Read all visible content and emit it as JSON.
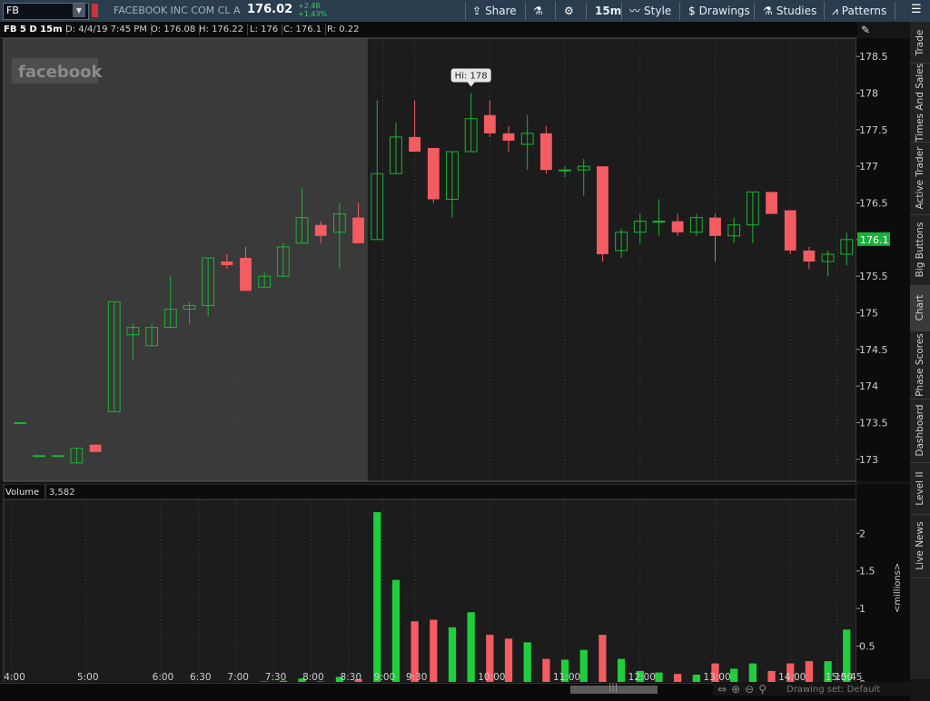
{
  "toolbar": {
    "symbol": "FB",
    "company": "FACEBOOK INC COM CL A",
    "last_price": "176.02",
    "change_abs": "+2.48",
    "change_pct": "+1.43%",
    "share_label": "Share",
    "timeframe_label": "15m",
    "style_label": "Style",
    "drawings_label": "Drawings",
    "studies_label": "Studies",
    "patterns_label": "Patterns",
    "icons": {
      "share": "share-icon",
      "flask": "flask-icon",
      "gear": "gear-icon",
      "style": "style-icon",
      "drawings": "drawings-icon",
      "studies": "studies-icon",
      "patterns": "patterns-icon",
      "menu": "menu-icon"
    }
  },
  "chart_header": {
    "symbol_label": "FB 5 D 15m",
    "date": "D: 4/4/19 7:45 PM",
    "open": "O: 176.08",
    "high": "H: 176.22",
    "low": "L: 176",
    "close": "C: 176.1",
    "range": "R: 0.22"
  },
  "watermark": "facebook",
  "high_bubble": "Hi: 178",
  "current_price_label": "176.1",
  "volume_panel": {
    "label": "Volume",
    "value": "3,582",
    "unit_label": "<millions>"
  },
  "sidebar_tabs": [
    "Trade",
    "Times And Sales",
    "Active Trader",
    "Big Buttons",
    "Chart",
    "Phase Scores",
    "Dashboard",
    "Level II",
    "Live News"
  ],
  "sidebar_active": "Chart",
  "footer": {
    "drawing_set": "Drawing set: Default"
  },
  "colors": {
    "up": "#19b533",
    "down": "#f45c62",
    "vol_up": "#1fce3c",
    "vol_down": "#f45c62",
    "premarket_bg": "#3a3a3a",
    "session_bg": "#1c1c1c",
    "price_tag": "#18b23a"
  },
  "chart_data": {
    "type": "candlestick",
    "y_price_ticks": [
      173,
      173.5,
      174,
      174.5,
      175,
      175.5,
      176,
      176.5,
      177,
      177.5,
      178,
      178.5
    ],
    "y_price_range": [
      172.7,
      178.75
    ],
    "y_volume_ticks": [
      0,
      0.5,
      1,
      1.5,
      2
    ],
    "y_volume_range": [
      0,
      2.45
    ],
    "x_ticks": [
      "4:00",
      "5:00",
      "6:00",
      "6:30",
      "7:00",
      "7:30",
      "8:00",
      "8:30",
      "9:00",
      "9:30",
      "10:00",
      "11:00",
      "12:00",
      "13:00",
      "14:00",
      "15:00",
      "15:45"
    ],
    "candles": [
      {
        "o": 173.5,
        "h": 173.5,
        "l": 173.5,
        "c": 173.5,
        "v": 0.005
      },
      {
        "o": 173.05,
        "h": 173.05,
        "l": 173.05,
        "c": 173.05,
        "v": 0.005
      },
      {
        "o": 173.05,
        "h": 173.05,
        "l": 173.05,
        "c": 173.05,
        "v": 0.005
      },
      {
        "o": 172.95,
        "h": 173.15,
        "l": 172.95,
        "c": 173.15,
        "v": 0.01
      },
      {
        "o": 173.2,
        "h": 173.2,
        "l": 173.1,
        "c": 173.1,
        "v": 0.01
      },
      {
        "o": 173.65,
        "h": 175.15,
        "l": 173.65,
        "c": 175.15,
        "v": 0.005
      },
      {
        "o": 174.7,
        "h": 174.85,
        "l": 174.35,
        "c": 174.8,
        "v": 0.01
      },
      {
        "o": 174.55,
        "h": 174.85,
        "l": 174.55,
        "c": 174.8,
        "v": 0.01
      },
      {
        "o": 174.8,
        "h": 175.5,
        "l": 174.8,
        "c": 175.05,
        "v": 0.02
      },
      {
        "o": 175.05,
        "h": 175.15,
        "l": 174.85,
        "c": 175.1,
        "v": 0.01
      },
      {
        "o": 175.1,
        "h": 175.75,
        "l": 174.95,
        "c": 175.75,
        "v": 0.02
      },
      {
        "o": 175.7,
        "h": 175.8,
        "l": 175.6,
        "c": 175.65,
        "v": 0.02
      },
      {
        "o": 175.75,
        "h": 175.9,
        "l": 175.3,
        "c": 175.3,
        "v": 0.02
      },
      {
        "o": 175.35,
        "h": 175.55,
        "l": 175.35,
        "c": 175.5,
        "v": 0.03
      },
      {
        "o": 175.5,
        "h": 175.95,
        "l": 175.5,
        "c": 175.9,
        "v": 0.04
      },
      {
        "o": 175.95,
        "h": 176.7,
        "l": 175.95,
        "c": 176.3,
        "v": 0.07
      },
      {
        "o": 176.2,
        "h": 176.25,
        "l": 175.95,
        "c": 176.05,
        "v": 0.03
      },
      {
        "o": 176.1,
        "h": 176.5,
        "l": 175.6,
        "c": 176.35,
        "v": 0.09
      },
      {
        "o": 176.3,
        "h": 176.5,
        "l": 175.95,
        "c": 175.95,
        "v": 0.06
      },
      {
        "o": 176.0,
        "h": 177.9,
        "l": 176.0,
        "c": 176.9,
        "v": 2.28
      },
      {
        "o": 176.9,
        "h": 177.6,
        "l": 176.9,
        "c": 177.4,
        "v": 1.38
      },
      {
        "o": 177.4,
        "h": 177.9,
        "l": 177.2,
        "c": 177.2,
        "v": 0.83
      },
      {
        "o": 177.25,
        "h": 177.25,
        "l": 176.5,
        "c": 176.55,
        "v": 0.85
      },
      {
        "o": 176.55,
        "h": 177.2,
        "l": 176.3,
        "c": 177.2,
        "v": 0.75
      },
      {
        "o": 177.2,
        "h": 178.0,
        "l": 177.2,
        "c": 177.65,
        "v": 0.95
      },
      {
        "o": 177.7,
        "h": 177.9,
        "l": 177.4,
        "c": 177.45,
        "v": 0.65
      },
      {
        "o": 177.45,
        "h": 177.55,
        "l": 177.2,
        "c": 177.35,
        "v": 0.6
      },
      {
        "o": 177.3,
        "h": 177.7,
        "l": 176.95,
        "c": 177.45,
        "v": 0.55
      },
      {
        "o": 177.45,
        "h": 177.55,
        "l": 176.9,
        "c": 176.95,
        "v": 0.33
      },
      {
        "o": 176.95,
        "h": 177.0,
        "l": 176.85,
        "c": 176.95,
        "v": 0.32
      },
      {
        "o": 176.95,
        "h": 177.1,
        "l": 176.6,
        "c": 177.0,
        "v": 0.45
      },
      {
        "o": 177.0,
        "h": 177.0,
        "l": 175.7,
        "c": 175.8,
        "v": 0.65
      },
      {
        "o": 175.85,
        "h": 176.15,
        "l": 175.75,
        "c": 176.1,
        "v": 0.33
      },
      {
        "o": 176.1,
        "h": 176.35,
        "l": 175.95,
        "c": 176.25,
        "v": 0.17
      },
      {
        "o": 176.25,
        "h": 176.55,
        "l": 176.05,
        "c": 176.25,
        "v": 0.15
      },
      {
        "o": 176.25,
        "h": 176.35,
        "l": 176.05,
        "c": 176.1,
        "v": 0.13
      },
      {
        "o": 176.1,
        "h": 176.35,
        "l": 176.05,
        "c": 176.3,
        "v": 0.12
      },
      {
        "o": 176.3,
        "h": 176.35,
        "l": 175.7,
        "c": 176.05,
        "v": 0.27
      },
      {
        "o": 176.05,
        "h": 176.3,
        "l": 175.95,
        "c": 176.2,
        "v": 0.2
      },
      {
        "o": 176.2,
        "h": 176.65,
        "l": 175.95,
        "c": 176.65,
        "v": 0.27
      },
      {
        "o": 176.65,
        "h": 176.65,
        "l": 176.35,
        "c": 176.35,
        "v": 0.17
      },
      {
        "o": 176.4,
        "h": 176.4,
        "l": 175.8,
        "c": 175.85,
        "v": 0.27
      },
      {
        "o": 175.85,
        "h": 175.9,
        "l": 175.6,
        "c": 175.7,
        "v": 0.3
      },
      {
        "o": 175.7,
        "h": 175.85,
        "l": 175.5,
        "c": 175.8,
        "v": 0.3
      },
      {
        "o": 175.8,
        "h": 176.1,
        "l": 175.65,
        "c": 176.0,
        "v": 0.72
      }
    ]
  }
}
